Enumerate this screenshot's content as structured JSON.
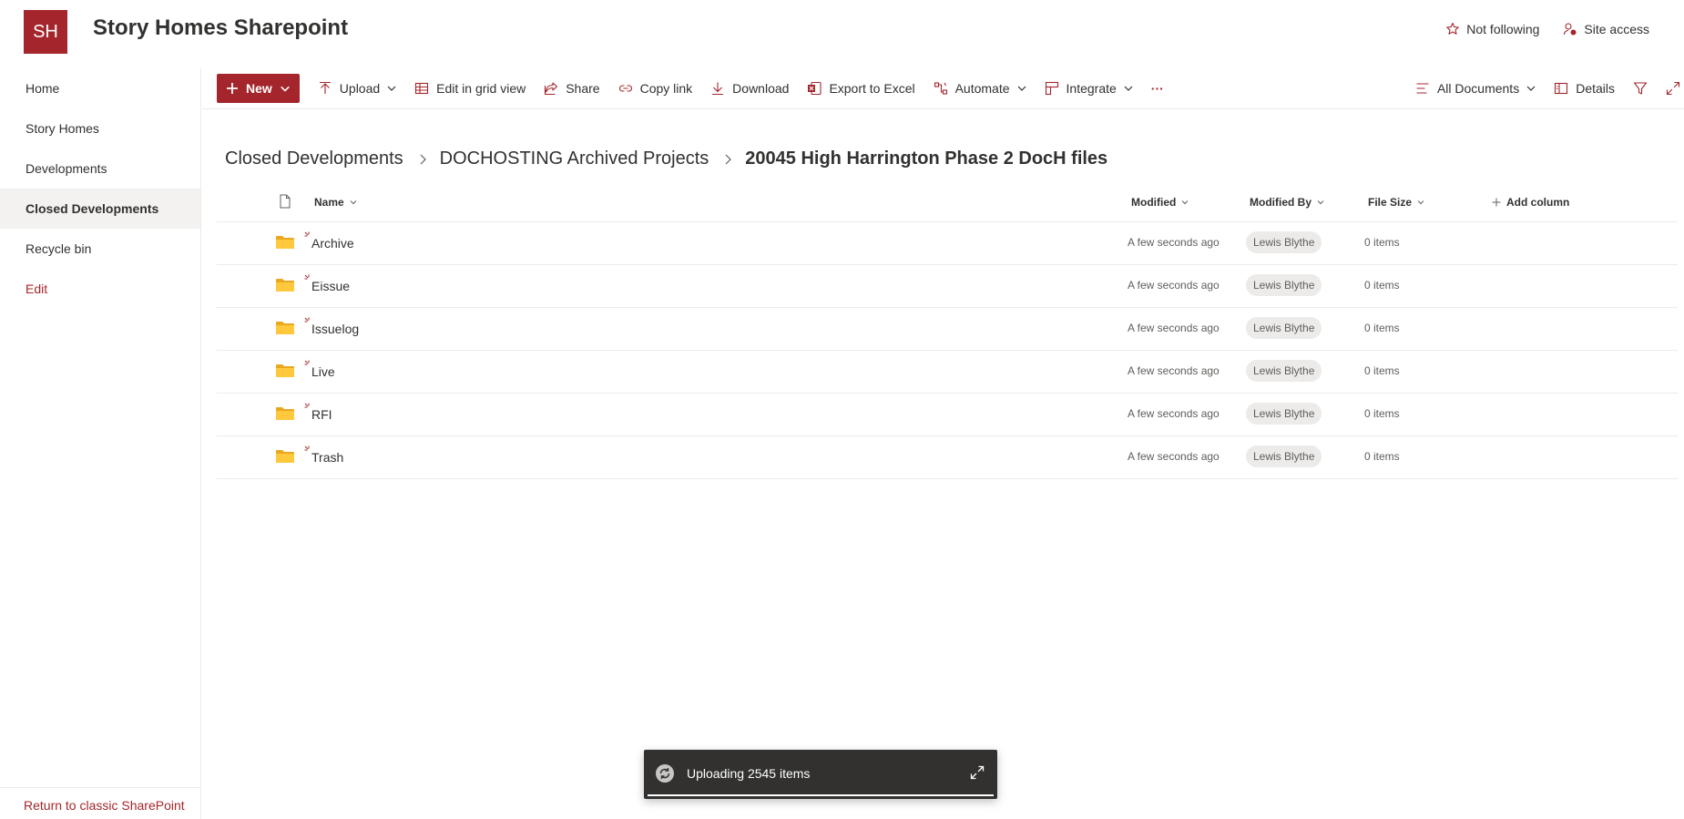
{
  "header": {
    "logo_text": "SH",
    "site_title": "Story Homes Sharepoint",
    "follow_label": "Not following",
    "site_access_label": "Site access",
    "brand_color": "#a4262c"
  },
  "nav": {
    "items": [
      {
        "label": "Home"
      },
      {
        "label": "Story Homes"
      },
      {
        "label": "Developments"
      },
      {
        "label": "Closed Developments"
      },
      {
        "label": "Recycle bin"
      }
    ],
    "edit_label": "Edit",
    "return_label": "Return to classic SharePoint"
  },
  "commandbar": {
    "new_label": "New",
    "upload_label": "Upload",
    "grid_label": "Edit in grid view",
    "share_label": "Share",
    "copylink_label": "Copy link",
    "download_label": "Download",
    "excel_label": "Export to Excel",
    "automate_label": "Automate",
    "integrate_label": "Integrate",
    "more_label": "···",
    "view_label": "All Documents",
    "details_label": "Details"
  },
  "breadcrumb": {
    "items": [
      "Closed Developments",
      "DOCHOSTING Archived Projects"
    ],
    "current": "20045 High Harrington Phase 2 DocH files"
  },
  "list": {
    "columns": {
      "name": "Name",
      "modified": "Modified",
      "modified_by": "Modified By",
      "file_size": "File Size",
      "add_column": "Add column"
    },
    "rows": [
      {
        "name": "Archive",
        "modified": "A few seconds ago",
        "modified_by": "Lewis Blythe",
        "size": "0 items"
      },
      {
        "name": "Eissue",
        "modified": "A few seconds ago",
        "modified_by": "Lewis Blythe",
        "size": "0 items"
      },
      {
        "name": "Issuelog",
        "modified": "A few seconds ago",
        "modified_by": "Lewis Blythe",
        "size": "0 items"
      },
      {
        "name": "Live",
        "modified": "A few seconds ago",
        "modified_by": "Lewis Blythe",
        "size": "0 items"
      },
      {
        "name": "RFI",
        "modified": "A few seconds ago",
        "modified_by": "Lewis Blythe",
        "size": "0 items"
      },
      {
        "name": "Trash",
        "modified": "A few seconds ago",
        "modified_by": "Lewis Blythe",
        "size": "0 items"
      }
    ]
  },
  "toast": {
    "text": "Uploading 2545 items",
    "progress": 1.0
  }
}
